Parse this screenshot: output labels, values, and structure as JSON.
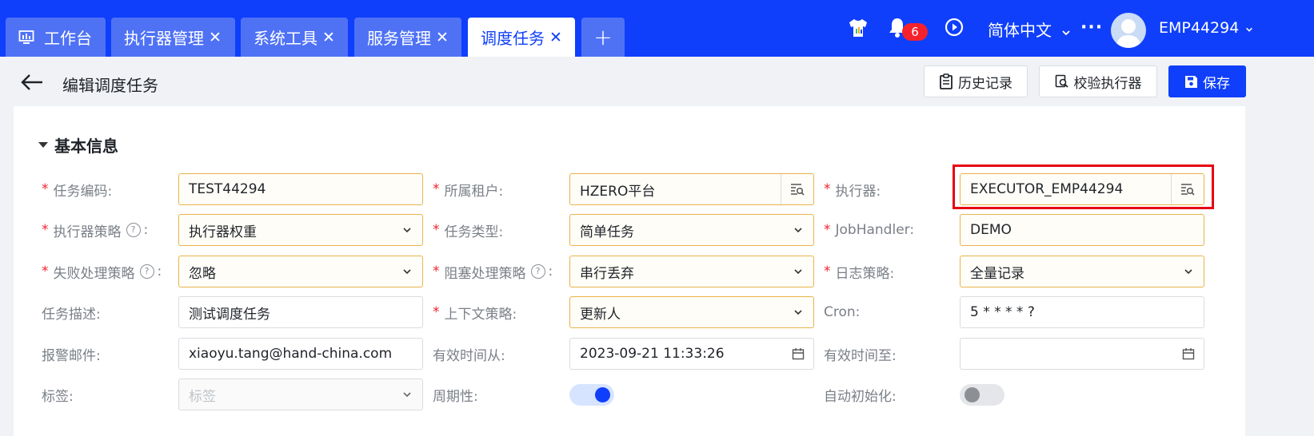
{
  "topbar": {
    "tabs": [
      {
        "label": "工作台",
        "closable": false,
        "active": false,
        "icon": "dashboard-icon"
      },
      {
        "label": "执行器管理",
        "closable": true,
        "active": false
      },
      {
        "label": "系统工具",
        "closable": true,
        "active": false
      },
      {
        "label": "服务管理",
        "closable": true,
        "active": false
      },
      {
        "label": "调度任务",
        "closable": true,
        "active": true
      }
    ],
    "close_glyph": "✕",
    "add_glyph": "+",
    "notification_count": "6",
    "language": "简体中文",
    "more_glyph": "···",
    "username": "EMP44294",
    "brand_color": "#0f3ffb"
  },
  "header": {
    "title": "编辑调度任务",
    "history_label": "历史记录",
    "validate_label": "校验执行器",
    "save_label": "保存"
  },
  "section": {
    "title": "基本信息"
  },
  "form": {
    "task_code": {
      "label": "任务编码:",
      "required": true,
      "value": "TEST44294"
    },
    "tenant": {
      "label": "所属租户:",
      "required": true,
      "value": "HZERO平台"
    },
    "executor": {
      "label": "执行器:",
      "required": true,
      "value": "EXECUTOR_EMP44294"
    },
    "executor_strategy": {
      "label": "执行器策略",
      "required": true,
      "value": "执行器权重"
    },
    "task_type": {
      "label": "任务类型:",
      "required": true,
      "value": "简单任务"
    },
    "job_handler": {
      "label": "JobHandler:",
      "required": true,
      "value": "DEMO"
    },
    "fail_strategy": {
      "label": "失败处理策略",
      "required": true,
      "value": "忽略"
    },
    "block_strategy": {
      "label": "阻塞处理策略",
      "required": true,
      "value": "串行丢弃"
    },
    "log_strategy": {
      "label": "日志策略:",
      "required": true,
      "value": "全量记录"
    },
    "task_desc": {
      "label": "任务描述:",
      "required": false,
      "value": "测试调度任务"
    },
    "context_strategy": {
      "label": "上下文策略:",
      "required": true,
      "value": "更新人"
    },
    "cron": {
      "label": "Cron:",
      "required": false,
      "value": "5 * * * * ?"
    },
    "alarm_email": {
      "label": "报警邮件:",
      "required": false,
      "value": "xiaoyu.tang@hand-china.com"
    },
    "valid_from": {
      "label": "有效时间从:",
      "required": false,
      "value": "2023-09-21 11:33:26"
    },
    "valid_to": {
      "label": "有效时间至:",
      "required": false,
      "value": ""
    },
    "tags": {
      "label": "标签:",
      "required": false,
      "placeholder": "标签"
    },
    "periodic": {
      "label": "周期性:",
      "on": true
    },
    "auto_init": {
      "label": "自动初始化:",
      "on": false
    }
  },
  "help_glyph": "?",
  "required_mark": "*",
  "colors": {
    "required_border": "#e8b44a",
    "required_mark": "#f5222d",
    "highlight_box": "#e60012"
  }
}
